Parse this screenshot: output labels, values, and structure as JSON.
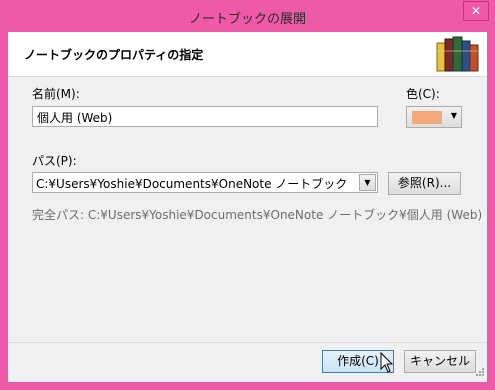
{
  "window": {
    "title": "ノートブックの展開",
    "close_label": "✕"
  },
  "header": {
    "title": "ノートブックのプロパティの指定"
  },
  "name": {
    "label": "名前(M):",
    "value": "個人用 (Web)"
  },
  "color": {
    "label": "色(C):",
    "value": "#f4a97c"
  },
  "path": {
    "label": "パス(P):",
    "value": "C:¥Users¥Yoshie¥Documents¥OneNote ノートブック",
    "browse_label": "参照(R)..."
  },
  "full_path": {
    "text": "完全パス: C:¥Users¥Yoshie¥Documents¥OneNote ノートブック¥個人用 (Web)"
  },
  "buttons": {
    "create_label": "作成(C)",
    "cancel_label": "キャンセル"
  }
}
